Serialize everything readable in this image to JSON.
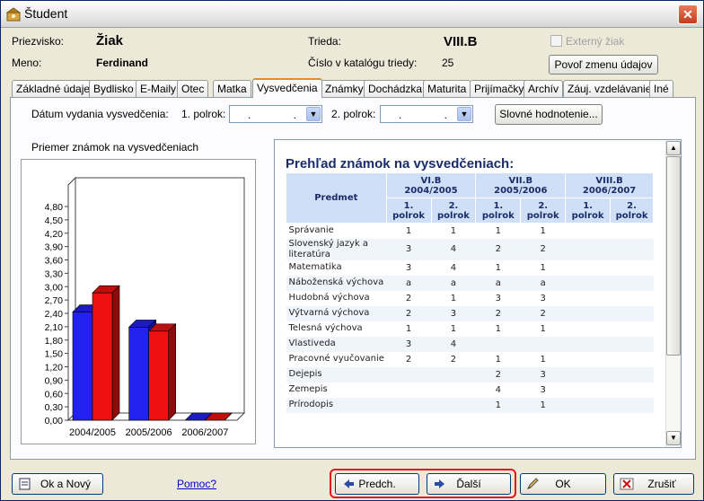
{
  "window": {
    "title": "Študent"
  },
  "header": {
    "surname_label": "Priezvisko:",
    "surname": "Žiak",
    "name_label": "Meno:",
    "name": "Ferdinand",
    "class_label": "Trieda:",
    "class": "VIII.B",
    "catalog_label": "Číslo v katalógu triedy:",
    "catalog": "25",
    "external_label": "Externý žiak",
    "allow_change_button": "Povoľ zmenu údajov"
  },
  "tabs": [
    "Základné údaje",
    "Bydlisko",
    "E-Maily",
    "Otec",
    "Matka",
    "Vysvedčenia",
    "Známky",
    "Dochádzka",
    "Maturita",
    "Prijímačky",
    "Archív",
    "Záuj. vzdelávanie",
    "Iné"
  ],
  "active_tab": "Vysvedčenia",
  "filters": {
    "issue_date_label": "Dátum vydania vysvedčenia:",
    "half1_label": "1. polrok:",
    "half1_value": ". .",
    "half2_label": "2. polrok:",
    "half2_value": ". .",
    "verbal_button": "Slovné hodnotenie..."
  },
  "chart_title": "Priemer známok na vysvedčeniach",
  "chart_data": {
    "type": "bar",
    "categories": [
      "2004/2005",
      "2005/2006",
      "2006/2007"
    ],
    "series": [
      {
        "color": "#2222ee",
        "values": [
          2.43,
          2.09,
          0.0
        ]
      },
      {
        "color": "#ee1111",
        "values": [
          2.86,
          2.0,
          0.0
        ]
      }
    ],
    "ylim": [
      0,
      4.8
    ],
    "yticks": [
      "0,00",
      "0,30",
      "0,60",
      "0,90",
      "1,20",
      "1,50",
      "1,80",
      "2,10",
      "2,40",
      "2,70",
      "3,00",
      "3,30",
      "3,60",
      "3,90",
      "4,20",
      "4,50",
      "4,80"
    ]
  },
  "report": {
    "title": "Prehľad známok na vysvedčeniach:",
    "subject_header": "Predmet",
    "years": [
      {
        "label": "VI.B",
        "year": "2004/2005"
      },
      {
        "label": "VII.B",
        "year": "2005/2006"
      },
      {
        "label": "VIII.B",
        "year": "2006/2007"
      }
    ],
    "half1": "1. polrok",
    "half2": "2. polrok",
    "rows": [
      {
        "subject": "Správanie",
        "g": [
          "1",
          "1",
          "1",
          "1",
          "",
          ""
        ]
      },
      {
        "subject": "Slovenský jazyk a literatúra",
        "g": [
          "3",
          "4",
          "2",
          "2",
          "",
          ""
        ]
      },
      {
        "subject": "Matematika",
        "g": [
          "3",
          "4",
          "1",
          "1",
          "",
          ""
        ]
      },
      {
        "subject": "Náboženská výchova",
        "g": [
          "a",
          "a",
          "a",
          "a",
          "",
          ""
        ]
      },
      {
        "subject": "Hudobná výchova",
        "g": [
          "2",
          "1",
          "3",
          "3",
          "",
          ""
        ]
      },
      {
        "subject": "Výtvarná výchova",
        "g": [
          "2",
          "3",
          "2",
          "2",
          "",
          ""
        ]
      },
      {
        "subject": "Telesná výchova",
        "g": [
          "1",
          "1",
          "1",
          "1",
          "",
          ""
        ]
      },
      {
        "subject": "Vlastiveda",
        "g": [
          "3",
          "4",
          "",
          "",
          "",
          ""
        ]
      },
      {
        "subject": "Pracovné vyučovanie",
        "g": [
          "2",
          "2",
          "1",
          "1",
          "",
          ""
        ]
      },
      {
        "subject": "Dejepis",
        "g": [
          "",
          "",
          "2",
          "3",
          "",
          ""
        ]
      },
      {
        "subject": "Zemepis",
        "g": [
          "",
          "",
          "4",
          "3",
          "",
          ""
        ]
      },
      {
        "subject": "Prírodopis",
        "g": [
          "",
          "",
          "1",
          "1",
          "",
          ""
        ]
      }
    ]
  },
  "buttons": {
    "ok_new": "Ok a Nový",
    "help": "Pomoc?",
    "prev": "Predch.",
    "next": "Ďalší",
    "ok": "OK",
    "cancel": "Zrušiť"
  }
}
